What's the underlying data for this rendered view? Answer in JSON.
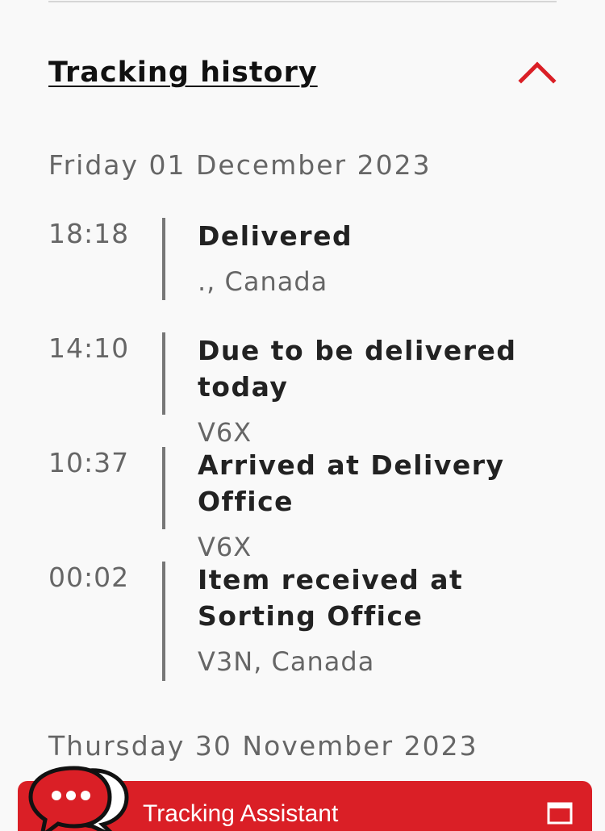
{
  "section": {
    "title": "Tracking history"
  },
  "groups": [
    {
      "date": "Friday 01 December 2023",
      "events": [
        {
          "time": "18:18",
          "status": "Delivered",
          "location": "., Canada"
        },
        {
          "time": "14:10",
          "status": "Due to be delivered today",
          "location": "V6X"
        },
        {
          "time": "10:37",
          "status": "Arrived at Delivery Office",
          "location": "V6X"
        },
        {
          "time": "00:02",
          "status": "Item received at Sorting Office",
          "location": "V3N, Canada"
        }
      ]
    },
    {
      "date": "Thursday 30 November 2023",
      "events": []
    }
  ],
  "assistant": {
    "label": "Tracking Assistant"
  },
  "colors": {
    "accent": "#da1f26",
    "timeline_bar": "#777777",
    "muted_text": "#666666"
  },
  "icons": {
    "collapse": "chevron-up-icon",
    "chat": "chat-bubbles-icon",
    "window": "window-icon"
  }
}
